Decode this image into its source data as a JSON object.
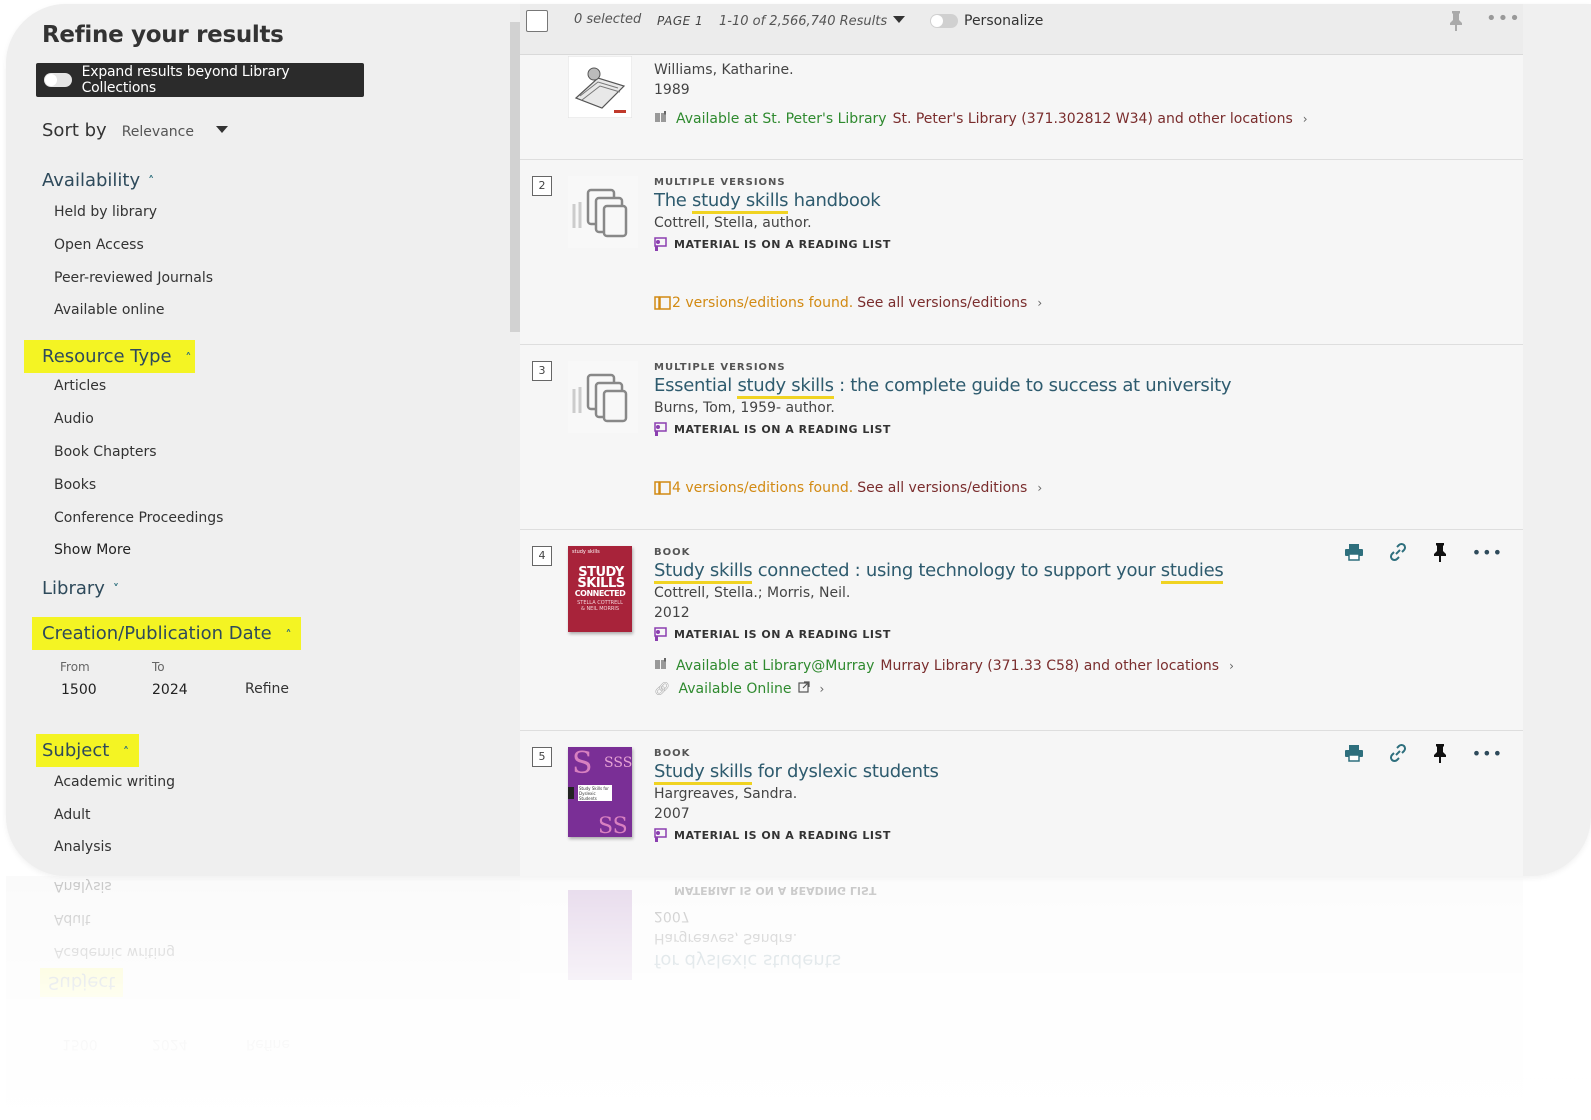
{
  "sidebar": {
    "title": "Refine your results",
    "expand_label": "Expand results beyond Library Collections",
    "sort_label": "Sort by",
    "sort_value": "Relevance",
    "availability": {
      "heading": "Availability",
      "items": [
        "Held by library",
        "Open Access",
        "Peer-reviewed Journals",
        "Available online"
      ]
    },
    "resource_type": {
      "heading": "Resource Type",
      "items": [
        "Articles",
        "Audio",
        "Book Chapters",
        "Books",
        "Conference Proceedings"
      ],
      "show_more": "Show More"
    },
    "library": {
      "heading": "Library"
    },
    "date": {
      "heading": "Creation/Publication Date",
      "from_label": "From",
      "to_label": "To",
      "from_value": "1500",
      "to_value": "2024",
      "refine": "Refine"
    },
    "subject": {
      "heading": "Subject",
      "items": [
        "Academic writing",
        "Adult",
        "Analysis"
      ]
    },
    "highlight_color": "#f4f423"
  },
  "toolbar": {
    "selected": "0 selected",
    "page": "PAGE 1",
    "results": "1-10 of 2,566,740 Results",
    "personalize": "Personalize"
  },
  "results": [
    {
      "author": "Williams, Katharine.",
      "year": "1989",
      "avail_status": "Available at St. Peter's Library",
      "avail_loc": "St. Peter's Library (371.302812 W34) and other locations"
    },
    {
      "num": "2",
      "type": "MULTIPLE VERSIONS",
      "title_pre": "The ",
      "title_hl": "study skills",
      "title_post": " handbook",
      "author": "Cottrell, Stella, author.",
      "reading": "MATERIAL IS ON A READING LIST",
      "versions": "2 versions/editions found.",
      "see_all": "See all versions/editions"
    },
    {
      "num": "3",
      "type": "MULTIPLE VERSIONS",
      "title_pre": "Essential ",
      "title_hl": "study skills",
      "title_post": " : the complete guide to success at university",
      "author": "Burns, Tom, 1959- author.",
      "reading": "MATERIAL IS ON A READING LIST",
      "versions": "4 versions/editions found.",
      "see_all": "See all versions/editions"
    },
    {
      "num": "4",
      "type": "BOOK",
      "title_hl": "Study skills",
      "title_mid": " connected : using technology to support your ",
      "title_hl2": "studies",
      "author": "Cottrell, Stella.; Morris, Neil.",
      "year": "2012",
      "reading": "MATERIAL IS ON A READING LIST",
      "avail_status": "Available at Library@Murray",
      "avail_loc": "Murray Library (371.33 C58) and other locations",
      "online": "Available Online",
      "cover_lines": [
        "study skills",
        "STUDY",
        "SKILLS",
        "CONNECTED",
        "STELLA COTTRELL",
        "& NEIL MORRIS"
      ]
    },
    {
      "num": "5",
      "type": "BOOK",
      "title_hl": "Study skills",
      "title_post": " for dyslexic students",
      "author": "Hargreaves, Sandra.",
      "year": "2007",
      "reading": "MATERIAL IS ON A READING LIST",
      "cover_lines": [
        "Study Skills for Dyslexic Students"
      ]
    }
  ],
  "colors": {
    "title_link": "#2e5b6e",
    "available_green": "#2f8a2f",
    "location_maroon": "#7a2d2d",
    "versions_orange": "#d28a13",
    "reading_icon_purple": "#8b3fb0",
    "action_icon_teal": "#2e6f7d"
  },
  "icons": [
    "toggle-icon",
    "sort-caret-icon",
    "chevron-up-icon",
    "chevron-down-icon",
    "checkbox-icon",
    "pin-icon",
    "more-icon",
    "print-icon",
    "link-icon",
    "reading-list-icon",
    "book-location-icon",
    "versions-icon",
    "external-link-icon",
    "arrow-right-icon"
  ]
}
